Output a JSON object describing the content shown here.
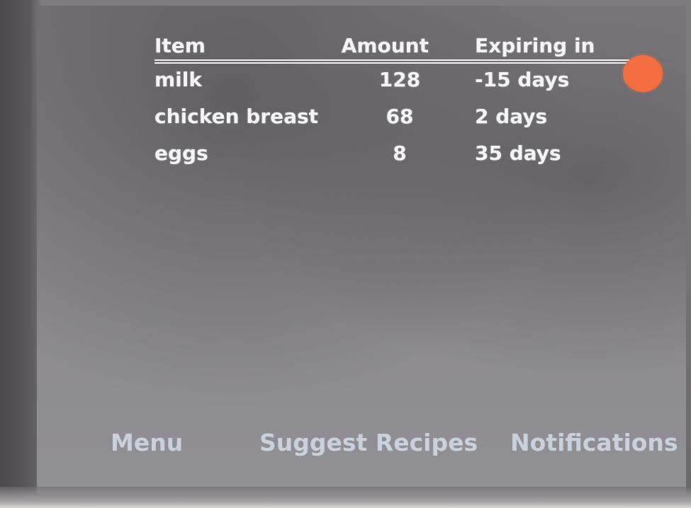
{
  "table": {
    "headers": {
      "item": "Item",
      "amount": "Amount",
      "expiring": "Expiring in"
    },
    "rows": [
      {
        "item": "milk",
        "amount": "128",
        "expiring": "-15 days"
      },
      {
        "item": "chicken breast",
        "amount": "68",
        "expiring": "2 days"
      },
      {
        "item": "eggs",
        "amount": "8",
        "expiring": "35 days"
      }
    ]
  },
  "status": {
    "alert_color": "#f26d3f"
  },
  "nav": {
    "menu": "Menu",
    "suggest_recipes": "Suggest Recipes",
    "notifications": "Notifications"
  },
  "icons": {
    "status_dot": "alert-dot-icon"
  }
}
